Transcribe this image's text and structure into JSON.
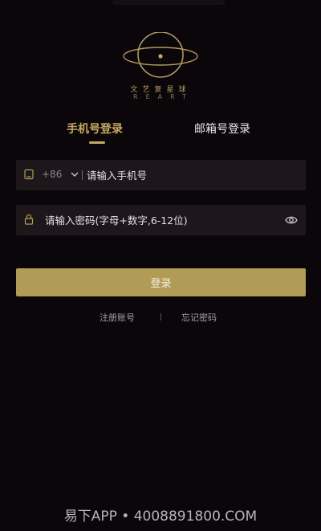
{
  "logo": {
    "name_cn": "文艺复星球",
    "name_en": "REART"
  },
  "tabs": [
    {
      "label": "手机号登录",
      "active": true
    },
    {
      "label": "邮箱号登录",
      "active": false
    }
  ],
  "phone_field": {
    "country_code": "+86",
    "placeholder": "请输入手机号"
  },
  "password_field": {
    "placeholder": "请输入密码(字母+数字,6-12位)"
  },
  "login_button": "登录",
  "links": {
    "register": "注册账号",
    "forgot": "忘记密码"
  },
  "watermark": "易下APP • 4008891800.COM",
  "colors": {
    "background": "#0b060a",
    "accent_gold": "#b29b56",
    "input_bg": "#1d171b"
  },
  "icons": [
    "planet-logo-icon",
    "phone-icon",
    "chevron-down-icon",
    "lock-icon",
    "eye-icon"
  ]
}
